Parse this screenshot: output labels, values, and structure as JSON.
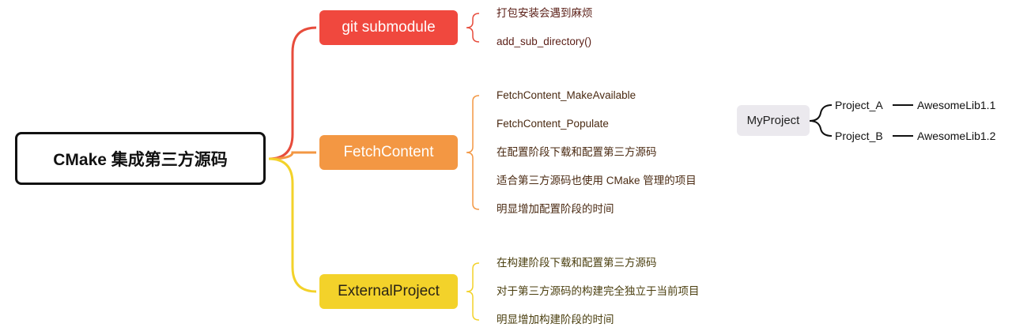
{
  "root": {
    "label": "CMake 集成第三方源码"
  },
  "branches": [
    {
      "label": "git submodule",
      "color": "#f0483e",
      "items": [
        "打包安装会遇到麻烦",
        "add_sub_directory()"
      ]
    },
    {
      "label": "FetchContent",
      "color": "#f39743",
      "items": [
        "FetchContent_MakeAvailable",
        "FetchContent_Populate",
        "在配置阶段下载和配置第三方源码",
        "适合第三方源码也使用 CMake 管理的项目",
        "明显增加配置阶段的时间"
      ]
    },
    {
      "label": "ExternalProject",
      "color": "#f3d22a",
      "items": [
        "在构建阶段下载和配置第三方源码",
        "对于第三方源码的构建完全独立于当前项目",
        "明显增加构建阶段的时间"
      ]
    }
  ],
  "side_diagram": {
    "root": "MyProject",
    "children": [
      {
        "label": "Project_A",
        "child": "AwesomeLib1.1"
      },
      {
        "label": "Project_B",
        "child": "AwesomeLib1.2"
      }
    ]
  }
}
